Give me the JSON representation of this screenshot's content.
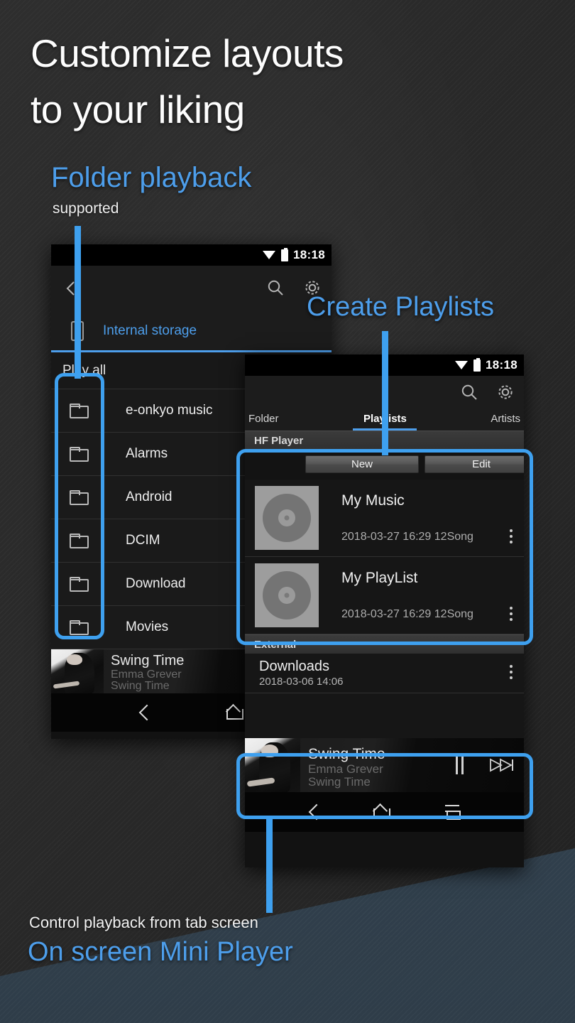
{
  "promo": {
    "headline_line1": "Customize layouts",
    "headline_line2": "to your liking",
    "feature_blue": "Folder playback",
    "feature_white": "supported",
    "mid_blue": "Create Playlists",
    "bottom_white": "Control playback from tab screen",
    "bottom_blue": "On screen Mini Player"
  },
  "colors": {
    "accent_blue": "#3ea0ef",
    "text_blue": "#4d9eeb",
    "background": "#2b2b2b",
    "wedge": "#31404d"
  },
  "phone_folder": {
    "statusbar": {
      "time": "18:18",
      "wifi_icon": "wifi-icon",
      "battery_icon": "battery-icon"
    },
    "appbar": {
      "back_icon": "back-chevron-icon",
      "search_icon": "search-icon",
      "settings_icon": "gear-icon"
    },
    "storage_tab": {
      "label": "Internal storage",
      "icon": "phone-storage-icon"
    },
    "play_all": "Play all",
    "folders": [
      {
        "name": "e-onkyo music",
        "icon": "folder-icon"
      },
      {
        "name": "Alarms",
        "icon": "folder-icon"
      },
      {
        "name": "Android",
        "icon": "folder-icon"
      },
      {
        "name": "DCIM",
        "icon": "folder-icon"
      },
      {
        "name": "Download",
        "icon": "folder-icon"
      },
      {
        "name": "Movies",
        "icon": "folder-icon"
      }
    ],
    "mini_player": {
      "title": "Swing Time",
      "artist": "Emma Grever",
      "album": "Swing Time"
    },
    "navbar": {
      "back_icon": "nav-back-icon",
      "home_icon": "nav-home-icon"
    }
  },
  "phone_playlist": {
    "statusbar": {
      "time": "18:18",
      "wifi_icon": "wifi-icon",
      "battery_icon": "battery-icon"
    },
    "appbar": {
      "search_icon": "search-icon",
      "settings_icon": "gear-icon"
    },
    "tabs": [
      {
        "label": "Folder",
        "active": false
      },
      {
        "label": "Playlists",
        "active": true
      },
      {
        "label": "Artists",
        "active": false
      }
    ],
    "sections": [
      {
        "header": "HF Player"
      },
      {
        "header": "External"
      }
    ],
    "actions": {
      "new_label": "New",
      "edit_label": "Edit"
    },
    "playlists": [
      {
        "name": "My Music",
        "meta": "2018-03-27 16:29  12Song",
        "art": "vinyl-album-art",
        "overflow_icon": "more-vertical-icon"
      },
      {
        "name": "My PlayList",
        "meta": "2018-03-27 16:29  12Song",
        "art": "vinyl-album-art",
        "overflow_icon": "more-vertical-icon"
      }
    ],
    "external_items": [
      {
        "name": "Downloads",
        "meta": "2018-03-06 14:06",
        "overflow_icon": "more-vertical-icon"
      }
    ],
    "mini_player": {
      "title": "Swing Time",
      "artist": "Emma Grever",
      "album": "Swing Time",
      "pause_icon": "pause-icon",
      "next_icon": "next-track-icon"
    },
    "navbar": {
      "back_icon": "nav-back-icon",
      "home_icon": "nav-home-icon",
      "recents_icon": "nav-recents-icon"
    }
  }
}
